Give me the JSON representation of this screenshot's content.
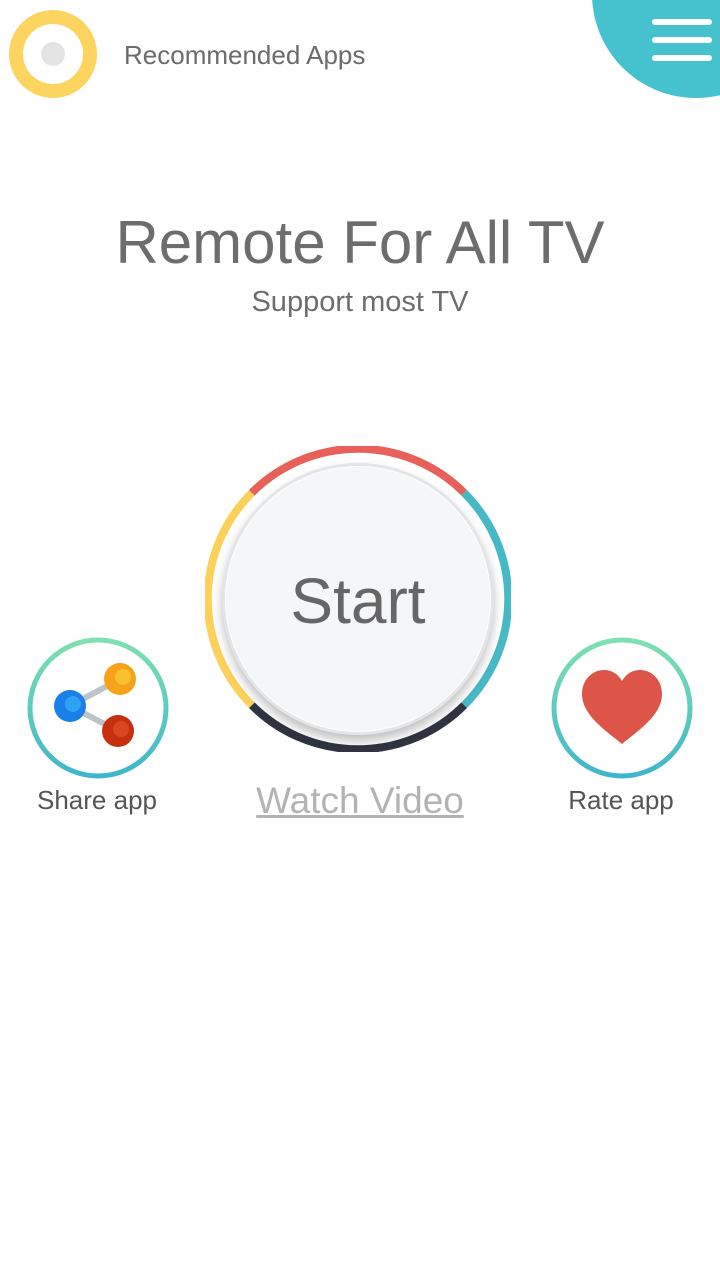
{
  "header": {
    "recommended_label": "Recommended Apps",
    "recommended_icon": "recommended-apps-icon",
    "menu_icon": "hamburger-menu-icon"
  },
  "main": {
    "title": "Remote For All TV",
    "subtitle": "Support most TV",
    "start_label": "Start",
    "watch_video_label": "Watch Video"
  },
  "actions": {
    "share_label": "Share app",
    "share_icon": "share-icon",
    "rate_label": "Rate app",
    "rate_icon": "heart-icon"
  },
  "colors": {
    "yellow": "#fdd460",
    "teal": "#46c2cf",
    "red": "#e8605a",
    "dark": "#2f3440",
    "text_gray": "#6d6d6d",
    "link_gray": "#b3b3b3"
  }
}
